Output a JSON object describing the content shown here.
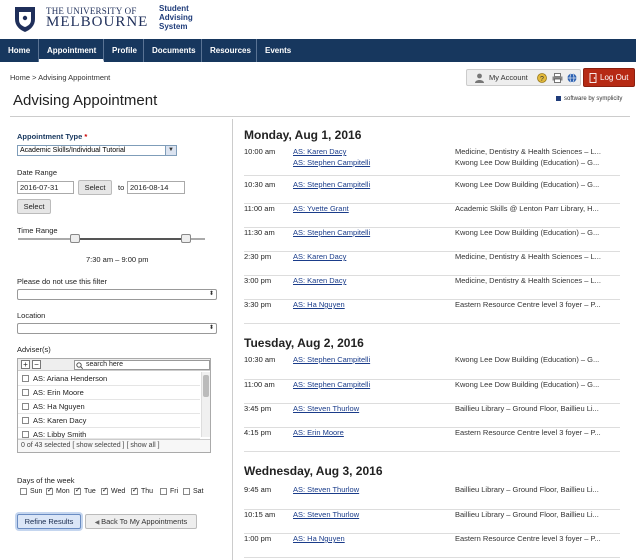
{
  "header": {
    "uni_line1": "THE UNIVERSITY OF",
    "uni_line2": "MELBOURNE",
    "system_name": "Student Advising System"
  },
  "nav": [
    {
      "label": "Home"
    },
    {
      "label": "Appointment"
    },
    {
      "label": "Profile"
    },
    {
      "label": "Documents"
    },
    {
      "label": "Resources"
    },
    {
      "label": "Events"
    }
  ],
  "breadcrumb": "Home > Advising Appointment",
  "page_title": "Advising Appointment",
  "account": {
    "my_account": "My Account",
    "logout": "Log Out",
    "powered": "software by symplicity"
  },
  "filters": {
    "appt_type_label": "Appointment Type",
    "appt_type_value": "Academic Skills/Individual Tutorial",
    "date_range_label": "Date Range",
    "date_from": "2016-07-31",
    "select_label": "Select",
    "to_label": "to",
    "date_to": "2016-08-14",
    "time_range_label": "Time Range",
    "time_range_value": "7:30 am – 9:00 pm",
    "no_filter_label": "Please do not use this filter",
    "location_label": "Location",
    "adviser_label": "Adviser(s)",
    "search_placeholder": "search here",
    "advisers": [
      {
        "name": "AS: Ariana Henderson"
      },
      {
        "name": "AS: Erin Moore"
      },
      {
        "name": "AS: Ha Nguyen"
      },
      {
        "name": "AS: Karen Dacy"
      },
      {
        "name": "AS: Libby Smith"
      }
    ],
    "adviser_footer": "0 of 43 selected  [ show selected ]  [ show all ]",
    "days_label": "Days of the week",
    "days": [
      {
        "label": "Sun",
        "checked": false
      },
      {
        "label": "Mon",
        "checked": true
      },
      {
        "label": "Tue",
        "checked": true
      },
      {
        "label": "Wed",
        "checked": true
      },
      {
        "label": "Thu",
        "checked": true
      },
      {
        "label": "Fri",
        "checked": false
      },
      {
        "label": "Sat",
        "checked": false
      }
    ],
    "refine_label": "Refine Results",
    "back_label": "Back To My Appointments"
  },
  "schedule": [
    {
      "date": "Monday, Aug 1, 2016",
      "appts": [
        {
          "time": "10:00 am",
          "advisers": [
            "AS: Karen Dacy",
            "AS: Stephen Campitelli"
          ],
          "locations": [
            "Medicine, Dentistry & Health Sciences – L...",
            "Kwong Lee Dow Building (Education) – G..."
          ]
        },
        {
          "time": "10:30 am",
          "advisers": [
            "AS: Stephen Campitelli"
          ],
          "locations": [
            "Kwong Lee Dow Building (Education) – G..."
          ]
        },
        {
          "time": "11:00 am",
          "advisers": [
            "AS: Yvette Grant"
          ],
          "locations": [
            "Academic Skills @ Lenton Parr Library, H..."
          ]
        },
        {
          "time": "11:30 am",
          "advisers": [
            "AS: Stephen Campitelli"
          ],
          "locations": [
            "Kwong Lee Dow Building (Education) – G..."
          ]
        },
        {
          "time": "2:30 pm",
          "advisers": [
            "AS: Karen Dacy"
          ],
          "locations": [
            "Medicine, Dentistry & Health Sciences – L..."
          ]
        },
        {
          "time": "3:00 pm",
          "advisers": [
            "AS: Karen Dacy"
          ],
          "locations": [
            "Medicine, Dentistry & Health Sciences – L..."
          ]
        },
        {
          "time": "3:30 pm",
          "advisers": [
            "AS: Ha Nguyen"
          ],
          "locations": [
            "Eastern Resource Centre level 3 foyer – P..."
          ]
        }
      ]
    },
    {
      "date": "Tuesday, Aug 2, 2016",
      "appts": [
        {
          "time": "10:30 am",
          "advisers": [
            "AS: Stephen Campitelli"
          ],
          "locations": [
            "Kwong Lee Dow Building (Education) – G..."
          ]
        },
        {
          "time": "11:00 am",
          "advisers": [
            "AS: Stephen Campitelli"
          ],
          "locations": [
            "Kwong Lee Dow Building (Education) – G..."
          ]
        },
        {
          "time": "3:45 pm",
          "advisers": [
            "AS: Steven Thurlow"
          ],
          "locations": [
            "Baillieu Library – Ground Floor, Baillieu Li..."
          ]
        },
        {
          "time": "4:15 pm",
          "advisers": [
            "AS: Erin Moore"
          ],
          "locations": [
            "Eastern Resource Centre level 3 foyer – P..."
          ]
        }
      ]
    },
    {
      "date": "Wednesday, Aug 3, 2016",
      "appts": [
        {
          "time": "9:45 am",
          "advisers": [
            "AS: Steven Thurlow"
          ],
          "locations": [
            "Baillieu Library – Ground Floor, Baillieu Li..."
          ]
        },
        {
          "time": "10:15 am",
          "advisers": [
            "AS: Steven Thurlow"
          ],
          "locations": [
            "Baillieu Library – Ground Floor, Baillieu Li..."
          ]
        },
        {
          "time": "1:00 pm",
          "advisers": [
            "AS: Ha Nguyen"
          ],
          "locations": [
            "Eastern Resource Centre level 3 foyer – P..."
          ]
        }
      ]
    }
  ]
}
